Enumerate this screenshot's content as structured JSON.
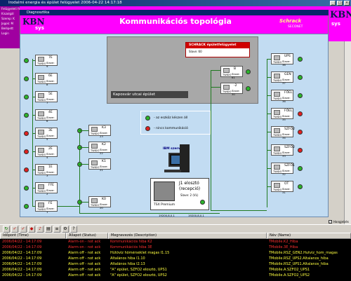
{
  "window": {
    "title": "Irodalmi energia és épület felügyelet 2006-04-22 14:17:18"
  },
  "inner_window": {
    "title": "Diagnosztika"
  },
  "left_panel": [
    "Felügyeleti felület",
    "Kiszolgál",
    "Szerep: K",
    "Jogok: M",
    "Belépett",
    "Login"
  ],
  "topology_title": "Kommunikációs topológia",
  "brand": {
    "left": "KBN",
    "left_suffix": "sys",
    "right_top": "Schrack",
    "right_sub": "SECONET",
    "right_logo": "KBN",
    "right_logo_suffix": "sys"
  },
  "building_label": "Kaposvár utcai épület",
  "schrack": {
    "title": "SCHRACK épületfelügyelet",
    "slave": "Slave: 60"
  },
  "legend": {
    "ok": "- az eszköz készen áll",
    "err": "- nincs kommunikáció"
  },
  "server_label": "IBM szerver",
  "plc": {
    "line1": "J1 elosztó",
    "line2": "(recepció)",
    "line3": "Slave: 2 (VL)",
    "brand": "TSX Premium"
  },
  "bus_labels": [
    "19200,8,0,1",
    "19200,8,0,1"
  ],
  "devices_left": [
    {
      "name": "7E",
      "slave": "Slave: 9",
      "led": "g"
    },
    {
      "name": "6E",
      "slave": "Slave: 8",
      "led": "g"
    },
    {
      "name": "5E",
      "slave": "Slave: 7",
      "led": "g"
    },
    {
      "name": "4E",
      "slave": "Slave: 6",
      "led": "g"
    },
    {
      "name": "3E",
      "slave": "Slave: 5",
      "led": "r"
    },
    {
      "name": "2E",
      "slave": "Slave: 4",
      "led": "r"
    },
    {
      "name": "1E",
      "slave": "Slave: 3",
      "led": "r"
    },
    {
      "name": "FFE",
      "slave": "Slave: 2",
      "led": "g"
    },
    {
      "name": "FE",
      "slave": "Slave: 1",
      "led": "g"
    }
  ],
  "devices_mid": [
    {
      "name": "K3",
      "slave": "Slave: 23",
      "led": "g"
    },
    {
      "name": "K2",
      "slave": "Slave: 22",
      "led": "g"
    },
    {
      "name": "K1",
      "slave": "Slave: 21",
      "led": "g"
    },
    {
      "name": "K0",
      "slave": "Slave: 20",
      "led": "g"
    }
  ],
  "devices_top": [
    {
      "name": "B",
      "slave": "Slave: 61",
      "led": "g"
    },
    {
      "name": "-2",
      "slave": "Slave: 30",
      "led": "g"
    }
  ],
  "devices_right": [
    {
      "name": "UPS",
      "slave": "Slave: 38",
      "led": "g"
    },
    {
      "name": "GEN",
      "slave": "Slave: 37",
      "led": "g"
    },
    {
      "name": "FŐEL",
      "slave": "Slave: 36",
      "led": "g"
    },
    {
      "name": "FŐEL",
      "slave": "Slave: 35",
      "led": "r"
    },
    {
      "name": "SZFŐ2",
      "slave": "Slave: 34",
      "led": "r"
    },
    {
      "name": "SZFŐ2",
      "slave": "Slave: 33",
      "led": "r"
    },
    {
      "name": "SZFŐ1",
      "slave": "Slave: 32",
      "led": "g"
    },
    {
      "name": "OT",
      "slave": "Slave: 31",
      "led": "g"
    }
  ],
  "device_type": "TWIDO",
  "checkbox_label": "Hangjelzés",
  "table": {
    "headers": [
      "Időpont (Time)",
      "Állapot (Status)",
      "Megnevezés (Description)",
      "Név (Name)"
    ],
    "rows": [
      {
        "time": "2006/04/22 - 14:17:09",
        "status": "Alarm-on - not ack",
        "desc": "Kommunikációs hiba K2",
        "name": "TMobile.K2_Hiba",
        "color": "#ff3030"
      },
      {
        "time": "2006/04/22 - 14:17:09",
        "status": "Alarm-on - not ack",
        "desc": "Kommunikációs hiba 3E",
        "name": "TMobile.3E_Hiba",
        "color": "#ff3030"
      },
      {
        "time": "2006/04/22 - 14:17:09",
        "status": "Alarm off - not ack",
        "desc": "Hűtővíz hőmérséklet magas I1.15",
        "name": "TMobile.RSZ_GEN2.Hutviz_hom_magas",
        "color": "#ffff40"
      },
      {
        "time": "2006/04/22 - 14:17:09",
        "status": "Alarm off - not ack",
        "desc": "Általános hiba I1.10",
        "name": "TMobile.RSZ_UPS2.Altalanos_hiba",
        "color": "#ffff40"
      },
      {
        "time": "2006/04/22 - 14:17:09",
        "status": "Alarm off - not ack",
        "desc": "Általános hiba I2.13",
        "name": "TMobile.RSZ_UPS1.Altalanos_hiba",
        "color": "#ffff40"
      },
      {
        "time": "2006/04/22 - 14:17:09",
        "status": "Alarm off - not ack",
        "desc": "\"A\" épület, SZFŐ2 elosztó, UPS1",
        "name": "TMobile.A.SZFŐ2_UPS1",
        "color": "#ffff40"
      },
      {
        "time": "2006/04/22 - 14:17:09",
        "status": "Alarm off - not ack",
        "desc": "\"A\" épület, SZFŐ2 elosztó, UPS2",
        "name": "TMobile.A.SZFŐ2_UPS2",
        "color": "#ffff40"
      }
    ]
  }
}
